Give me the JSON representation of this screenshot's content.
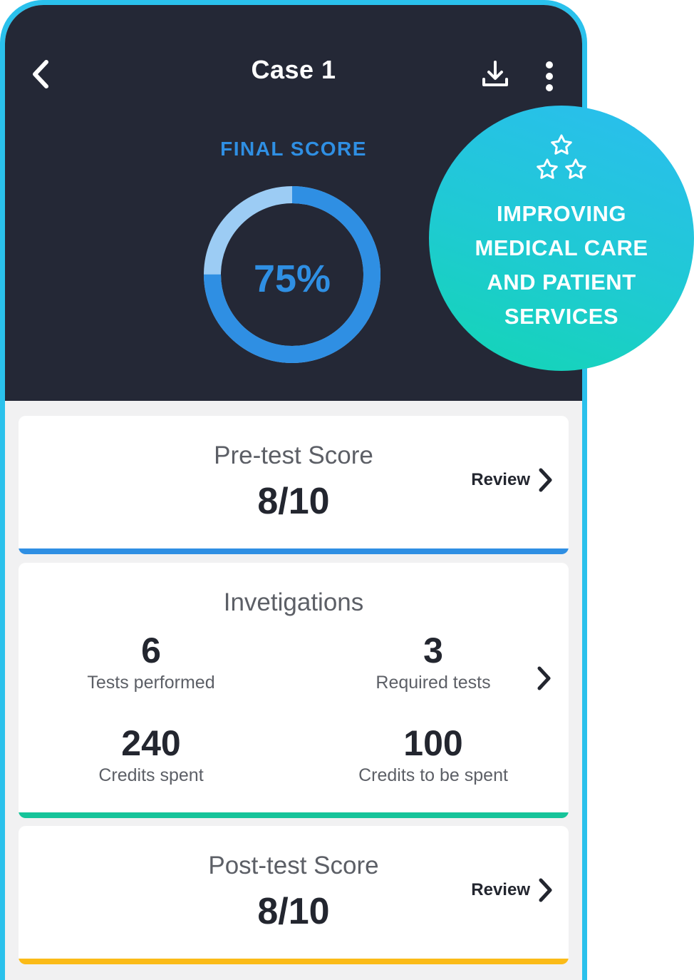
{
  "header": {
    "title": "Case 1",
    "back_icon": "chevron-left-icon",
    "download_icon": "download-icon",
    "more_icon": "more-vertical-icon"
  },
  "final_score": {
    "label": "FINAL SCORE",
    "value_text": "75%",
    "value_percent": 75,
    "colors": {
      "fill": "#2f8fe3",
      "track": "#9cccf4"
    }
  },
  "pretest": {
    "title": "Pre-test Score",
    "score": "8/10",
    "review_label": "Review",
    "bar_color": "#2f8fe3"
  },
  "investigations": {
    "title": "Invetigations",
    "stats": [
      {
        "value": "6",
        "label": "Tests performed"
      },
      {
        "value": "3",
        "label": "Required tests"
      },
      {
        "value": "240",
        "label": "Credits spent"
      },
      {
        "value": "100",
        "label": "Credits to be spent"
      }
    ],
    "bar_color": "#16c49a"
  },
  "posttest": {
    "title": "Post-test Score",
    "score": "8/10",
    "review_label": "Review",
    "bar_color": "#fbbb18"
  },
  "badge": {
    "icon": "stars-icon",
    "lines": [
      "IMPROVING",
      "MEDICAL CARE",
      "AND PATIENT",
      "SERVICES"
    ]
  },
  "colors": {
    "frame": "#2ac1ec",
    "header_bg": "#242836",
    "screen_bg": "#f1f1f2"
  }
}
